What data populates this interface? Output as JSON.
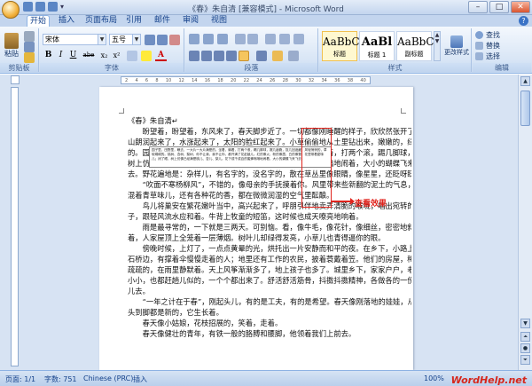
{
  "window": {
    "title": "《春》朱自清 [兼容模式] - Microsoft Word"
  },
  "tabs": [
    "开始",
    "插入",
    "页面布局",
    "引用",
    "邮件",
    "审阅",
    "视图"
  ],
  "ribbon": {
    "clipboard": {
      "label": "剪贴板",
      "paste": "粘贴"
    },
    "font": {
      "label": "字体",
      "name": "宋体",
      "size": "五号",
      "bold": "B",
      "italic": "I",
      "underline": "U",
      "strike": "abe",
      "sub": "x₂",
      "sup": "x²",
      "color_a": "A"
    },
    "paragraph": {
      "label": "段落"
    },
    "styles": {
      "label": "样式",
      "items": [
        {
          "sample": "AaBbC",
          "name": "标题"
        },
        {
          "sample": "AaBl",
          "name": "标题 1"
        },
        {
          "sample": "AaBbC",
          "name": "副标题"
        }
      ],
      "change": "更改样式"
    },
    "editing": {
      "label": "编辑",
      "find": "查找",
      "replace": "替换",
      "select": "选择"
    }
  },
  "ruler": {
    "ticks": [
      "2",
      "4",
      "6",
      "8",
      "10",
      "12",
      "14",
      "16",
      "18",
      "20",
      "22",
      "24",
      "26",
      "28",
      "30",
      "32",
      "34",
      "36",
      "38",
      "40"
    ]
  },
  "document": {
    "paragraphs": [
      "《春》朱自清↵",
      "　　盼望着，盼望着，东风来了，春天脚步近了。一切都像刚睡醒的样子，欣欣然张开了眼。",
      "山朗润起来了，水涨起来了，太阳的脸红起来了。小草偷偷地从土里钻出来，嫩嫩的，绿绿",
      "的。园子里，田野里，瞧去，一大片一大片满是的。坐着，躺着，打两个滚，踢几脚球，赛几趟跑，捉几回迷藏。风轻悄悄的，草软绵绵的。桃树、杏树、梨树，你不让我，我不让你，都开满了花赶趟儿。红的像火，粉的像霞，白的像雪。花里带着甜味儿；闭了眼，",
      "树上仿佛已经满是桃儿、杏儿、梨儿。花下成千成百的蜜蜂嗡嗡地闹着，大小的蝴蝶飞来飞",
      "去。野花遍地是：杂样儿，有名字的，没名字的，散在草丛里像眼睛，像星星，还眨呀眨的。",
      "　　“吹面不寒杨柳风”，不错的，像母亲的手抚摸着你。风里带来些新翻的泥土的气息，",
      "混着青草味儿，还有各种花的香，都在微微润湿的空气里酝酿。",
      "　　鸟儿将巢安在繁花嫩叶当中，高兴起来了，呼朋引伴地卖弄清脆的喉咙，唱出宛转的曲",
      "子，跟轻风流水应和着。牛背上牧童的短笛，这时候也成天嘹亮地响着。",
      "　　雨是最寻常的，一下就是三两天。可别恼。看，像牛毛，像花针，像细丝，密密地斜织",
      "着，人家屋顶上全笼着一层薄烟。树叶儿却绿得发亮，小草儿也青得逼你的眼。",
      "　　傍晚时候，上灯了，一点点黄晕的光，烘托出一片安静而和平的夜。在乡下，小路上，",
      "石桥边，有撑着伞慢慢走着的人；地里还有工作的农民，披着蓑戴着笠。他们的房屋，稀稀",
      "疏疏的，在雨里静默着。天上风筝渐渐多了，地上孩子也多了。城里乡下，家家户户，老老",
      "小小，也都赶趟儿似的，一个个都出来了。舒活舒活筋骨，抖擞抖擞精神，各做各的一份事",
      "儿去。",
      "　　“一年之计在于春”，刚起头儿，有的是工夫，有的是希望。春天像刚落地的娃娃，从",
      "头到脚都是新的，它生长着。",
      "　　春天像小姑娘，花枝招展的，笑着，走着。",
      "　　春天像健壮的青年，有铁一般的胳膊和腰脚，他领着我们上前去。"
    ],
    "popup_text": "园子里，田野里，瞧去，一大片一大片满是的。坐着，躺着，打两个滚，踢几脚球，赛几趟跑，捉几回迷藏。风轻悄悄的，草软绵绵的。桃树、杏树、梨树，你不让我，我不让你，都开满了花赶趟儿。红的像火，粉的像霞，白的像雪。花里带着甜味儿；闭了眼，树上仿佛已经满是桃儿、杏儿、梨儿。花下成千成百的蜜蜂嗡嗡地闹着，大小的蝴蝶飞来飞去。"
  },
  "annotation": {
    "callout": "查看效果"
  },
  "status": {
    "page": "页面: 1/1",
    "words": "字数: 751",
    "language": "Chinese (PRC)",
    "mode": "插入",
    "zoom": "100%"
  },
  "watermark": "WordHelp.net",
  "colors": {
    "accent": "#e0231c",
    "ribbon": "#c3d5ee"
  }
}
